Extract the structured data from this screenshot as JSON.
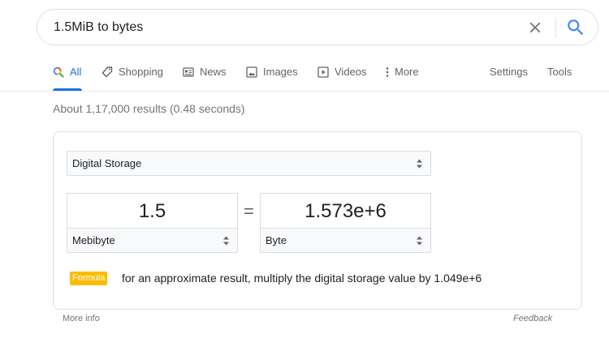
{
  "search": {
    "query": "1.5MiB to bytes"
  },
  "tabs": [
    {
      "label": "All",
      "icon": "search-icon",
      "active": true
    },
    {
      "label": "Shopping",
      "icon": "tag-icon"
    },
    {
      "label": "News",
      "icon": "newspaper-icon"
    },
    {
      "label": "Images",
      "icon": "image-icon"
    },
    {
      "label": "Videos",
      "icon": "play-icon"
    },
    {
      "label": "More",
      "icon": "vertical-dots-icon"
    }
  ],
  "tools": {
    "settings": "Settings",
    "tools": "Tools"
  },
  "result_stats": "About 1,17,000 results (0.48 seconds)",
  "converter": {
    "category": "Digital Storage",
    "input_value": "1.5",
    "input_unit": "Mebibyte",
    "output_value": "1.573e+6",
    "output_unit": "Byte",
    "equals": "=",
    "formula_label": "Formula",
    "formula_text": "for an approximate result, multiply the digital storage value by 1.049e+6"
  },
  "footer": {
    "more_info": "More info",
    "feedback": "Feedback"
  },
  "colors": {
    "accent": "#1a73e8",
    "formula_badge": "#fbbc04"
  }
}
